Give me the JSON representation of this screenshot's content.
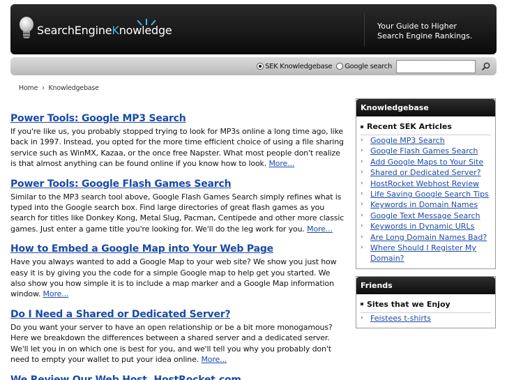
{
  "header": {
    "logo_text_a": "SearchEngine",
    "logo_text_b": "K",
    "logo_text_c": "nowledge",
    "tagline_line1": "Your Guide to Higher",
    "tagline_line2": "Search Engine Rankings."
  },
  "search": {
    "option1": "SEK Knowledgebase",
    "option2": "Google search",
    "selected": "option1",
    "input_value": "",
    "button_icon": "search-icon"
  },
  "breadcrumb": {
    "home": "Home",
    "separator": "›",
    "current": "Knowledgebase"
  },
  "articles": [
    {
      "title": "Power Tools: Google MP3 Search",
      "body": "If you're like us, you probably stopped trying to look for MP3s online a long time ago, like back in 1997. Instead, you opted for the more time efficient choice of using a file sharing service such as WinMX, Kazaa, or the once free Napster. What most people don't realize is that almost anything can be found online if you know how to look.",
      "more": "More..."
    },
    {
      "title": "Power Tools: Google Flash Games Search",
      "body": "Similar to the MP3 search tool above, Google Flash Games Search simply refines what is typed into the Google search box. Find large directories of great flash games as you search for titles like Donkey Kong, Metal Slug, Pacman, Centipede and other more classic games. Just enter a game title you're looking for. We'll do the leg work for you.",
      "more": "More..."
    },
    {
      "title": "How to Embed a Google Map into Your Web Page",
      "body": "Have you always wanted to add a Google Map to your web site? We show you just how easy it is by giving you the code for a simple Google map to help get you started. We also show you how simple it is to include a map marker and a Google Map information window.",
      "more": "More..."
    },
    {
      "title": "Do I Need a Shared or Dedicated Server?",
      "body": "Do you want your server to have an open relationship or be a bit more monogamous? Here we breakdown the differences between a shared server and a dedicated server. We'll let you in on which one is best for you, and we'll tell you why you probably don't need to empty your wallet to put your idea online.",
      "more": "More..."
    },
    {
      "title": "We Review Our Web Host, HostRocket.com",
      "body": "",
      "more": ""
    }
  ],
  "sidebar": {
    "knowledgebase": {
      "heading": "Knowledgebase",
      "subheading": "Recent SEK Articles",
      "links": [
        "Google MP3 Search",
        "Google Flash Games Search",
        "Add Google Maps to Your Site",
        "Shared or Dedicated Server?",
        "HostRocket Webhost Review",
        "Life Saving Google Search Tips",
        "Keywords in Domain Names",
        "Google Text Message Search",
        "Keywords in Dynamic URLs",
        "Are Long Domain Names Bad?",
        "Where Should I Register My Domain?"
      ]
    },
    "friends": {
      "heading": "Friends",
      "subheading": "Sites that we Enjoy",
      "links": [
        "Feistees t-shirts"
      ]
    },
    "arrow_glyph": "›"
  },
  "colors": {
    "link": "#1a4aa8",
    "accent": "#4ab3f0",
    "header_bg": "#111111"
  }
}
